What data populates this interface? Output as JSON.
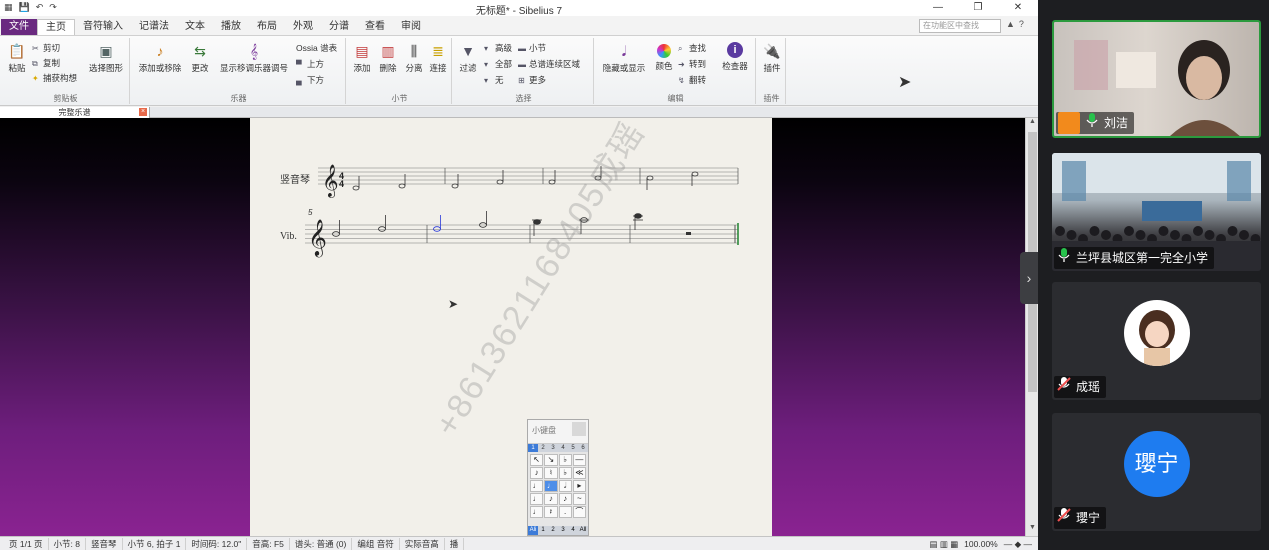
{
  "window": {
    "title": "无标题* - Sibelius 7"
  },
  "tabs": [
    {
      "label": "文件",
      "style": "file"
    },
    {
      "label": "主页",
      "style": "active"
    },
    {
      "label": "音符输入",
      "style": ""
    },
    {
      "label": "记谱法",
      "style": ""
    },
    {
      "label": "文本",
      "style": ""
    },
    {
      "label": "播放",
      "style": ""
    },
    {
      "label": "布局",
      "style": ""
    },
    {
      "label": "外观",
      "style": ""
    },
    {
      "label": "分谱",
      "style": ""
    },
    {
      "label": "查看",
      "style": ""
    },
    {
      "label": "审阅",
      "style": ""
    }
  ],
  "search": {
    "placeholder": "在功能区中查找"
  },
  "ribbon": {
    "clipboard": {
      "label": "剪贴板",
      "paste": "粘贴",
      "cut": "剪切",
      "copy": "复制",
      "capture_idea": "捕获构想",
      "select_graphic": "选择图形"
    },
    "instruments": {
      "label": "乐器",
      "add_remove": "添加或移除",
      "change": "更改",
      "show_transposing": "显示移调乐器调号",
      "ossia_title": "Ossia 谱表",
      "above": "上方",
      "below": "下方"
    },
    "bars": {
      "label": "小节",
      "add": "添加",
      "delete": "删除",
      "split": "分离",
      "join": "连接"
    },
    "selection": {
      "label": "选择",
      "filter": "过滤",
      "advanced": "高级",
      "all": "全部",
      "none": "无",
      "bar": "小节",
      "system_passage": "总谱连续区域",
      "more": "更多"
    },
    "edit": {
      "label": "编辑",
      "hide_show": "隐藏或显示",
      "color": "颜色",
      "find": "查找",
      "goto": "转到",
      "flip": "翻转",
      "inspector": "检查器"
    },
    "plugins": {
      "label": "插件",
      "plugins": "插件"
    }
  },
  "document": {
    "tab_label": "完整乐谱"
  },
  "score": {
    "staff1_name": "竖音琴",
    "staff2_name": "Vib.",
    "staff2_bar_number": "5"
  },
  "keypad": {
    "title": "小键盘",
    "tabs": [
      "1",
      "2",
      "3",
      "4",
      "5",
      "6"
    ],
    "active_tab": 0,
    "keys": [
      "↖",
      "↘",
      "♭",
      "—",
      "♪",
      "♮",
      "♭",
      "≪",
      "♩",
      "♩",
      "𝅗𝅥",
      "▸",
      "♩",
      "♪",
      "♪",
      "~",
      "♩",
      "𝄽",
      ".",
      "⌒"
    ],
    "footer": [
      "Ali",
      "1",
      "2",
      "3",
      "4",
      "All"
    ]
  },
  "statusbar": {
    "items": [
      "页 1/1 页",
      "小节: 8",
      "竖音琴",
      "小节 6, 拍子 1",
      "时间码: 12.0\"",
      "音高: F5",
      "谱头: 普通 (0)",
      "编组 音符",
      "实际音高",
      "播"
    ],
    "zoom": "100.00%"
  },
  "watermark": "+8613621168405成瑶",
  "meeting": {
    "participants": [
      {
        "name": "刘洁",
        "type": "video-teacher",
        "mic": "on",
        "badge": true
      },
      {
        "name": "兰坪县城区第一完全小学",
        "type": "video-class",
        "mic": "on",
        "badge": false
      },
      {
        "name": "成瑶",
        "type": "avatar-photo",
        "mic": "muted",
        "badge": false
      },
      {
        "name": "瓔宁",
        "type": "avatar-text",
        "avatar_text": "瓔宁",
        "mic": "muted",
        "badge": false
      }
    ]
  },
  "colors": {
    "file_tab": "#6a2a80",
    "workspace_purple": "#8a2391",
    "active_speaker_border": "#2b9a3e",
    "avatar_blue": "#1e7cf0",
    "mic_green": "#27c24c",
    "mic_muted": "#f05050"
  }
}
